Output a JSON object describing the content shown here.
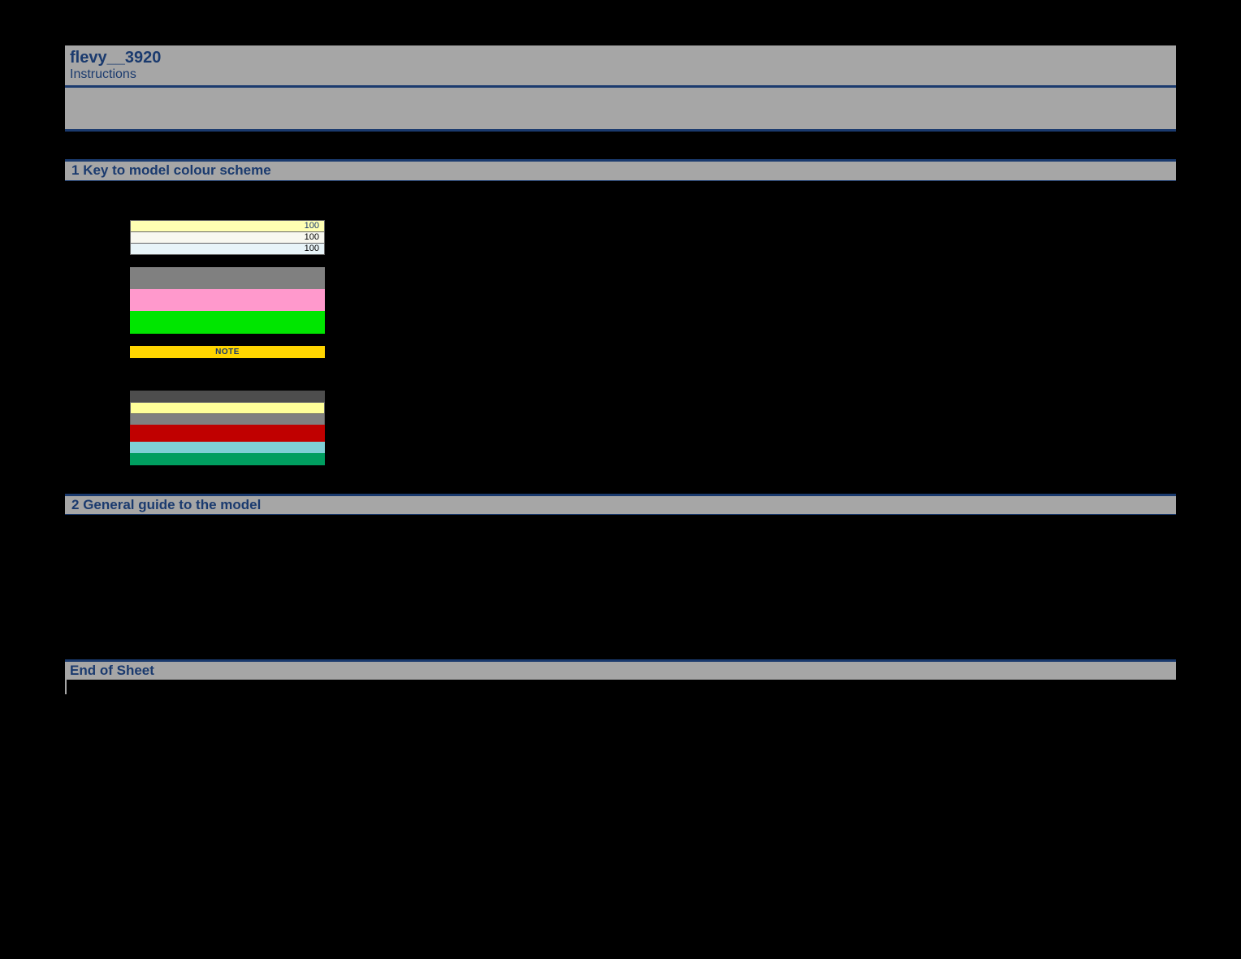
{
  "header": {
    "title": "flevy__3920",
    "subtitle": "Instructions"
  },
  "sections": {
    "s1": {
      "num": "1",
      "title": "Key to model colour scheme"
    },
    "s2": {
      "num": "2",
      "title": "General guide to the model"
    }
  },
  "key_rows": {
    "r1_value": "100",
    "r2_value": "100",
    "r3_value": "100",
    "note_label": "NOTE"
  },
  "footer": {
    "label": "End of Sheet"
  }
}
